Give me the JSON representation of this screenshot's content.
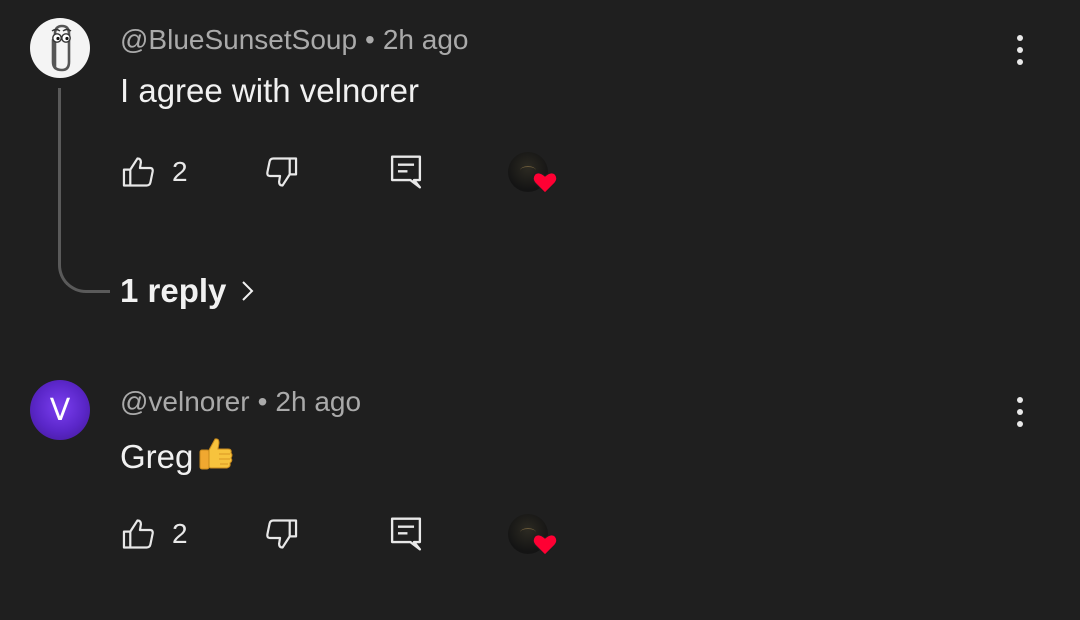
{
  "comments": [
    {
      "author": "@BlueSunsetSoup",
      "separator": "•",
      "time": "2h ago",
      "text": "I agree with velnorer",
      "likes": "2",
      "avatar_icon": "paperclip-icon",
      "has_creator_heart": true,
      "replies_label": "1 reply"
    },
    {
      "author": "@velnorer",
      "separator": "•",
      "time": "2h ago",
      "text": "Greg",
      "text_emoji": "thumbs-up-emoji",
      "likes": "2",
      "avatar_letter": "V",
      "has_creator_heart": true
    }
  ],
  "colors": {
    "background": "#1f1f1f",
    "meta_text": "#aaaaaa",
    "primary_text": "#f1f1f1",
    "heart": "#ff0033",
    "avatar_purple": "#5a26c8"
  }
}
